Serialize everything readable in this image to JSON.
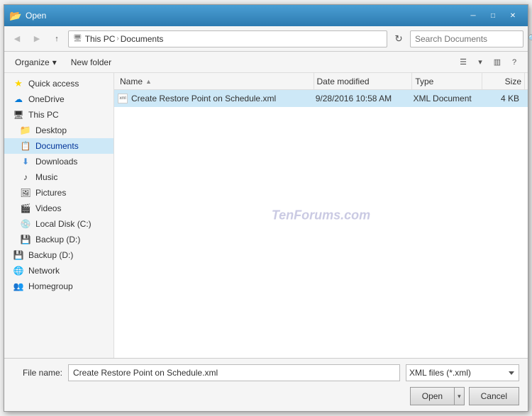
{
  "title_bar": {
    "title": "Open",
    "close_label": "✕",
    "minimize_label": "─",
    "maximize_label": "□"
  },
  "address_bar": {
    "breadcrumb": {
      "parts": [
        "This PC",
        "Documents"
      ]
    },
    "search_placeholder": "Search Documents",
    "refresh_icon": "↻"
  },
  "toolbar": {
    "organize_label": "Organize",
    "organize_arrow": "▾",
    "new_folder_label": "New folder"
  },
  "watermark": "TenForums.com",
  "sidebar": {
    "items": [
      {
        "id": "quick-access",
        "icon": "⭐",
        "label": "Quick access",
        "icon_type": "star"
      },
      {
        "id": "onedrive",
        "icon": "☁",
        "label": "OneDrive",
        "icon_type": "cloud"
      },
      {
        "id": "this-pc",
        "icon": "💻",
        "label": "This PC",
        "icon_type": "computer"
      },
      {
        "id": "desktop",
        "icon": "📁",
        "label": "Desktop",
        "icon_type": "folder",
        "indent": true
      },
      {
        "id": "documents",
        "icon": "📄",
        "label": "Documents",
        "icon_type": "docs",
        "indent": true,
        "active": true
      },
      {
        "id": "downloads",
        "icon": "⬇",
        "label": "Downloads",
        "icon_type": "download",
        "indent": true
      },
      {
        "id": "music",
        "icon": "♪",
        "label": "Music",
        "icon_type": "music",
        "indent": true
      },
      {
        "id": "pictures",
        "icon": "🖼",
        "label": "Pictures",
        "icon_type": "pictures",
        "indent": true
      },
      {
        "id": "videos",
        "icon": "🎬",
        "label": "Videos",
        "icon_type": "videos",
        "indent": true
      },
      {
        "id": "local-disk-c",
        "icon": "💿",
        "label": "Local Disk (C:)",
        "icon_type": "drive",
        "indent": true
      },
      {
        "id": "backup-d-1",
        "icon": "💾",
        "label": "Backup (D:)",
        "icon_type": "drive",
        "indent": true
      },
      {
        "id": "backup-d-2",
        "icon": "💾",
        "label": "Backup (D:)",
        "icon_type": "drive"
      },
      {
        "id": "network",
        "icon": "🌐",
        "label": "Network",
        "icon_type": "network"
      },
      {
        "id": "homegroup",
        "icon": "👥",
        "label": "Homegroup",
        "icon_type": "homegroup"
      }
    ]
  },
  "file_list": {
    "columns": [
      {
        "id": "name",
        "label": "Name",
        "sort_indicator": "▲"
      },
      {
        "id": "date",
        "label": "Date modified"
      },
      {
        "id": "type",
        "label": "Type"
      },
      {
        "id": "size",
        "label": "Size"
      }
    ],
    "files": [
      {
        "id": "file-1",
        "name": "Create Restore Point on Schedule.xml",
        "date": "9/28/2016 10:58 AM",
        "type": "XML Document",
        "size": "4 KB",
        "selected": true
      }
    ]
  },
  "bottom_bar": {
    "filename_label": "File name:",
    "filename_value": "Create Restore Point on Schedule.xml",
    "filetype_value": "XML files (*.xml)",
    "open_label": "Open",
    "cancel_label": "Cancel"
  }
}
